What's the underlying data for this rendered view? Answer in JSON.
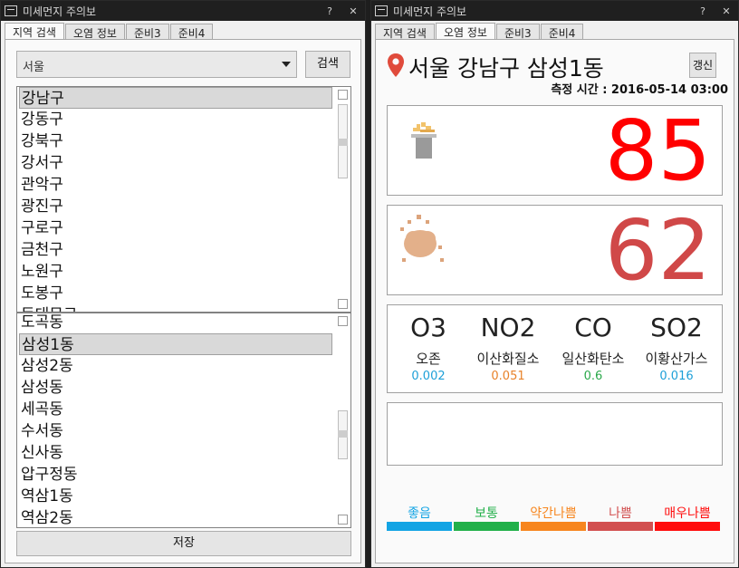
{
  "left_window": {
    "title": "미세먼지 주의보",
    "help_label": "?",
    "close_label": "✕",
    "tabs": [
      "지역 검색",
      "오염 정보",
      "준비3",
      "준비4"
    ],
    "city_select_value": "서울",
    "search_label": "검색",
    "district_list": [
      "강남구",
      "강동구",
      "강북구",
      "강서구",
      "관악구",
      "광진구",
      "구로구",
      "금천구",
      "노원구",
      "도봉구",
      "동대문구"
    ],
    "dong_list": [
      "도곡동",
      "삼성1동",
      "삼성2동",
      "삼성동",
      "세곡동",
      "수서동",
      "신사동",
      "압구정동",
      "역삼1동",
      "역삼2동"
    ],
    "save_label": "저장"
  },
  "right_window": {
    "title": "미세먼지 주의보",
    "help_label": "?",
    "close_label": "✕",
    "tabs": [
      "지역 검색",
      "오염 정보",
      "준비3",
      "준비4"
    ],
    "location": "서울 강남구 삼성1동",
    "refresh_label": "갱신",
    "measure_time": "측정 시간 : 2016-05-14 03:00",
    "pm10_value": "85",
    "pm25_value": "62",
    "gases": [
      {
        "symbol": "O3",
        "name": "오존",
        "value": "0.002",
        "color": "#1ea0d8"
      },
      {
        "symbol": "NO2",
        "name": "이산화질소",
        "value": "0.051",
        "color": "#e8822a"
      },
      {
        "symbol": "CO",
        "name": "일산화탄소",
        "value": "0.6",
        "color": "#2aa84a"
      },
      {
        "symbol": "SO2",
        "name": "이황산가스",
        "value": "0.016",
        "color": "#1ea0d8"
      }
    ],
    "legend": [
      {
        "label": "좋음",
        "color": "#13a4e4"
      },
      {
        "label": "보통",
        "color": "#22b04a"
      },
      {
        "label": "약간나쁨",
        "color": "#f7861f"
      },
      {
        "label": "나쁨",
        "color": "#d25050"
      },
      {
        "label": "매우나쁨",
        "color": "#ff0d0d"
      }
    ],
    "colors": {
      "pm10": "#ff0000",
      "pm25": "#d04848",
      "pin": "#e04b3c"
    }
  }
}
